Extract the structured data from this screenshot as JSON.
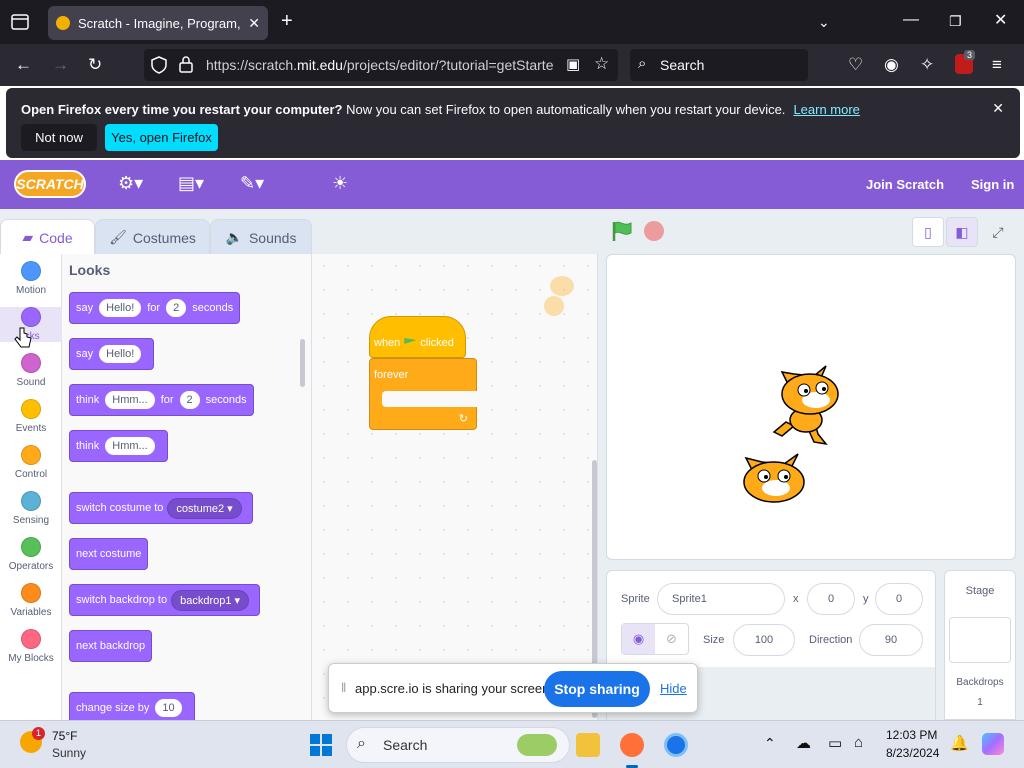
{
  "browser": {
    "tab_title": "Scratch - Imagine, Program, Sh",
    "url_prefix": "https://scratch.",
    "url_host": "mit.edu",
    "url_rest": "/projects/editor/?tutorial=getStarte",
    "search_placeholder": "Search",
    "extension_badge": "3"
  },
  "notification": {
    "bold": "Open Firefox every time you restart your computer?",
    "text": " Now you can set Firefox to open automatically when you restart your device.",
    "link": "Learn more",
    "btn_not_now": "Not now",
    "btn_yes": "Yes, open Firefox"
  },
  "scratch_menu": {
    "logo": "SCRATCH",
    "join": "Join Scratch",
    "signin": "Sign in"
  },
  "editor_tabs": [
    "Code",
    "Costumes",
    "Sounds"
  ],
  "categories": [
    {
      "label": "Motion",
      "color": "#4c97ff"
    },
    {
      "label": "Looks",
      "color": "#9966ff"
    },
    {
      "label": "Sound",
      "color": "#cf63cf"
    },
    {
      "label": "Events",
      "color": "#ffbf00"
    },
    {
      "label": "Control",
      "color": "#ffab19"
    },
    {
      "label": "Sensing",
      "color": "#5cb1d6"
    },
    {
      "label": "Operators",
      "color": "#59c059"
    },
    {
      "label": "Variables",
      "color": "#ff8c1a"
    },
    {
      "label": "My Blocks",
      "color": "#ff6680"
    }
  ],
  "categories_selected_partial": "icks",
  "palette": {
    "title": "Looks",
    "blocks": {
      "say_for": [
        "say",
        "Hello!",
        "for",
        "2",
        "seconds"
      ],
      "say": [
        "say",
        "Hello!"
      ],
      "think_for": [
        "think",
        "Hmm...",
        "for",
        "2",
        "seconds"
      ],
      "think": [
        "think",
        "Hmm..."
      ],
      "switch_costume": [
        "switch costume to",
        "costume2"
      ],
      "next_costume": [
        "next costume"
      ],
      "switch_backdrop": [
        "switch backdrop to",
        "backdrop1"
      ],
      "next_backdrop": [
        "next backdrop"
      ],
      "change_size": [
        "change size by",
        "10"
      ]
    }
  },
  "script": {
    "hat": [
      "when",
      "clicked"
    ],
    "forever": "forever"
  },
  "sprite_info": {
    "sprite_label": "Sprite",
    "sprite_name": "Sprite1",
    "x_label": "x",
    "x": "0",
    "y_label": "y",
    "y": "0",
    "size_label": "Size",
    "size": "100",
    "direction_label": "Direction",
    "direction": "90"
  },
  "stage_panel": {
    "title": "Stage",
    "backdrops_label": "Backdrops",
    "backdrops_count": "1"
  },
  "share_bar": {
    "text": "app.scre.io is sharing your screen.",
    "stop": "Stop sharing",
    "hide": "Hide"
  },
  "taskbar": {
    "weather_temp": "75°F",
    "weather_desc": "Sunny",
    "weather_badge": "1",
    "search": "Search",
    "time": "12:03 PM",
    "date": "8/23/2024"
  },
  "colors": {
    "scratch_purple": "#855cd6",
    "looks": "#9966ff",
    "events": "#ffbf00",
    "control": "#ffab19",
    "firefox_dark": "#1c1b22",
    "share_blue": "#1a73e8"
  }
}
